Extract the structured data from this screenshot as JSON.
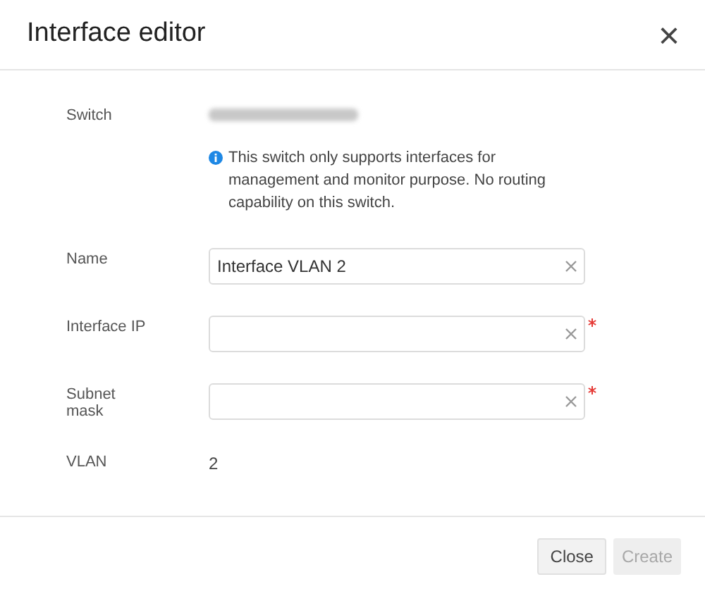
{
  "dialog": {
    "title": "Interface editor",
    "close_icon": "×"
  },
  "switch_row": {
    "label": "Switch"
  },
  "info_note": "This switch only supports interfaces for management and monitor purpose. No routing capability on this switch.",
  "fields": [
    {
      "label": "Name",
      "value": "Interface VLAN 2",
      "required": false
    },
    {
      "label": "Interface IP",
      "required": true
    },
    {
      "label": "Subnet mask",
      "required": true
    }
  ],
  "vlan": {
    "label": "VLAN",
    "value": "2"
  },
  "buttons": [
    {
      "label": "Close",
      "disabled": false
    },
    {
      "label": "Create",
      "disabled": true
    }
  ]
}
